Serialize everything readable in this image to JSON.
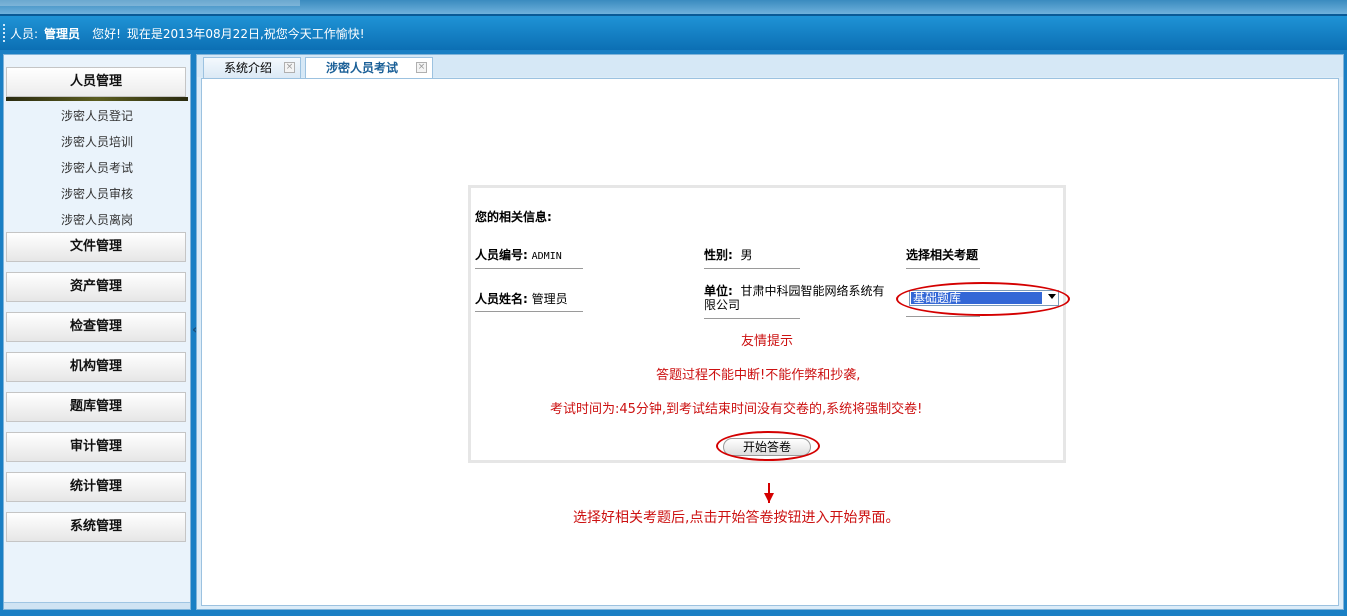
{
  "header": {
    "user_label": "人员:",
    "user_name": "管理员",
    "greeting": "您好!",
    "date_text": "现在是2013年08月22日,祝您今天工作愉快!"
  },
  "sidebar": {
    "menus": [
      {
        "label": "人员管理",
        "sub": [
          "涉密人员登记",
          "涉密人员培训",
          "涉密人员考试",
          "涉密人员审核",
          "涉密人员离岗"
        ]
      },
      {
        "label": "文件管理"
      },
      {
        "label": "资产管理"
      },
      {
        "label": "检查管理"
      },
      {
        "label": "机构管理"
      },
      {
        "label": "题库管理"
      },
      {
        "label": "审计管理"
      },
      {
        "label": "统计管理"
      },
      {
        "label": "系统管理"
      }
    ],
    "collapse_symbol": "«"
  },
  "tabs": [
    {
      "label": "系统介绍",
      "close": "×"
    },
    {
      "label": "涉密人员考试",
      "close": "×"
    }
  ],
  "exam": {
    "section_title": "您的相关信息:",
    "id_label": "人员编号:",
    "id_value": "ADMIN",
    "name_label": "人员姓名:",
    "name_value": "管理员",
    "gender_label": "性别:",
    "gender_value": "男",
    "unit_label": "单位:",
    "unit_value_line1": "甘肃中科园智能网络系统有",
    "unit_value_line2": "限公司",
    "select_title": "选择相关考题",
    "select_value": "基础题库",
    "tip_title": "友情提示",
    "tip_line1": "答题过程不能中断!不能作弊和抄袭,",
    "tip_line2": "考试时间为:45分钟,到考试结束时间没有交卷的,系统将强制交卷!",
    "start_button": "开始答卷"
  },
  "annotation": {
    "hint": "选择好相关考题后,点击开始答卷按钮进入开始界面。",
    "color": "#d40000"
  }
}
